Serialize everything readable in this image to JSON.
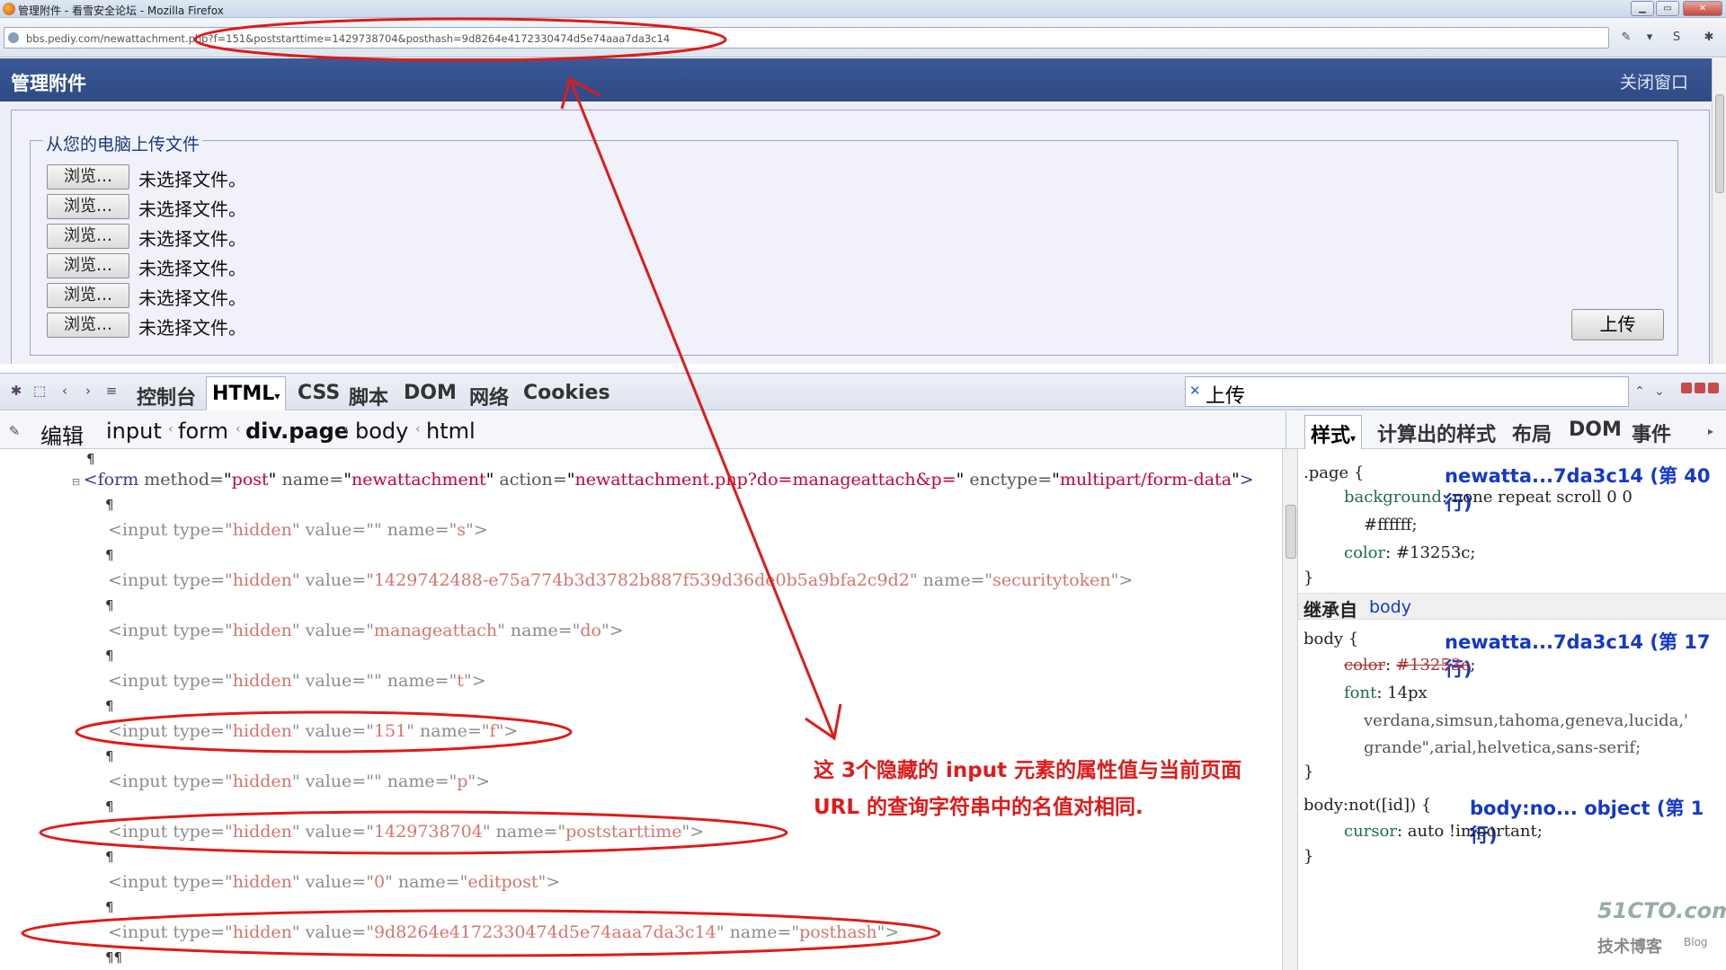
{
  "window": {
    "title": "管理附件 - 看雪安全论坛 - Mozilla Firefox",
    "url": "bbs.pediy.com/newattachment.php?f=151&poststarttime=1429738704&posthash=9d8264e4172330474d5e74aaa7da3c14"
  },
  "page": {
    "header_title": "管理附件",
    "close_label": "关闭窗口",
    "fieldset_legend": "从您的电脑上传文件",
    "file_rows": [
      {
        "button": "浏览…",
        "status": "未选择文件。"
      },
      {
        "button": "浏览…",
        "status": "未选择文件。"
      },
      {
        "button": "浏览…",
        "status": "未选择文件。"
      },
      {
        "button": "浏览…",
        "status": "未选择文件。"
      },
      {
        "button": "浏览…",
        "status": "未选择文件。"
      },
      {
        "button": "浏览…",
        "status": "未选择文件。"
      }
    ],
    "upload_button": "上传"
  },
  "firebug": {
    "tabs": [
      "控制台",
      "HTML",
      "CSS",
      "脚本",
      "DOM",
      "网络",
      "Cookies"
    ],
    "selected_tab": "HTML",
    "search_value": "上传",
    "breadcrumb": [
      "编辑",
      "input",
      "form",
      "div.page",
      "body",
      "html"
    ],
    "side_tabs": [
      "样式",
      "计算出的样式",
      "布局",
      "DOM",
      "事件"
    ],
    "html_lines": {
      "form": {
        "tag": "<form",
        "method": "post",
        "name": "newattachment",
        "action": "newattachment.php?do=manageattach&p=",
        "enctype": "multipart/form-data",
        "close": ">"
      },
      "inputs": [
        {
          "value": "",
          "name": "s"
        },
        {
          "value": "1429742488-e75a774b3d3782b887f539d36de0b5a9bfa2c9d2",
          "name": "securitytoken"
        },
        {
          "value": "manageattach",
          "name": "do"
        },
        {
          "value": "",
          "name": "t"
        },
        {
          "value": "151",
          "name": "f"
        },
        {
          "value": "",
          "name": "p"
        },
        {
          "value": "1429738704",
          "name": "poststarttime"
        },
        {
          "value": "0",
          "name": "editpost"
        },
        {
          "value": "9d8264e4172330474d5e74aaa7da3c14",
          "name": "posthash"
        }
      ]
    },
    "styles": {
      "rule1": {
        "selector": ".page {",
        "source": "newatta...7da3c14 (第 40 行)",
        "background": "none repeat scroll 0 0",
        "background_cont": "#ffffff;",
        "color": "#13253c;"
      },
      "inherited_label": "继承自",
      "inherited_link": "body",
      "rule2": {
        "selector": "body {",
        "source": "newatta...7da3c14 (第 17 行)",
        "color_struck": "#13253c",
        "font": "14px",
        "font_cont1": "verdana,simsun,tahoma,geneva,lucida,'",
        "font_cont2": "grande\",arial,helvetica,sans-serif;"
      },
      "rule3": {
        "selector": "body:not([id]) {",
        "source": "body:no... object (第 1 行)",
        "cursor": "auto !important;"
      }
    }
  },
  "annotation": {
    "line1": "这 3个隐藏的 input 元素的属性值与当前页面",
    "line2": "URL 的查询字符串中的名值对相同."
  },
  "watermark": {
    "brand": "51CTO.com",
    "sub": "技术博客",
    "blog": "Blog"
  },
  "colors": {
    "header_bg": "#34508d",
    "annotation_red": "#e01a1a",
    "link_blue": "#1538c9"
  }
}
